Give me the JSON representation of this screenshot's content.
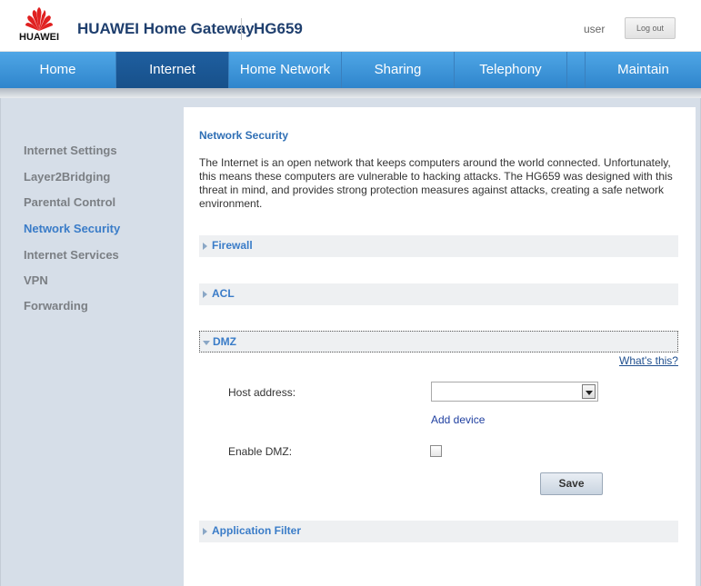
{
  "header": {
    "logo_text": "HUAWEI",
    "title": "HUAWEI Home Gateway",
    "model": "HG659",
    "user_label": "user",
    "logout_label": "Log out"
  },
  "nav": {
    "items": [
      {
        "label": "Home"
      },
      {
        "label": "Internet"
      },
      {
        "label": "Home Network"
      },
      {
        "label": "Sharing"
      },
      {
        "label": "Telephony"
      },
      {
        "label": "Maintain"
      }
    ],
    "active": "Internet"
  },
  "sidebar": {
    "items": [
      {
        "label": "Internet Settings"
      },
      {
        "label": "Layer2Bridging"
      },
      {
        "label": "Parental Control"
      },
      {
        "label": "Network Security"
      },
      {
        "label": "Internet Services"
      },
      {
        "label": "VPN"
      },
      {
        "label": "Forwarding"
      }
    ],
    "active": "Network Security"
  },
  "main": {
    "title": "Network Security",
    "intro": "The Internet is an open network that keeps computers around the world connected. Unfortunately, this means these computers are vulnerable to hacking attacks. The HG659 was designed with this threat in mind, and provides strong protection measures against attacks, creating a safe network environment.",
    "sections": {
      "firewall": "Firewall",
      "acl": "ACL",
      "dmz": "DMZ",
      "app_filter": "Application Filter"
    },
    "dmz": {
      "whats_this": "What's this?",
      "host_address_label": "Host address:",
      "host_address_value": "",
      "add_device": "Add device",
      "enable_label": "Enable DMZ:",
      "enabled": false,
      "save_label": "Save"
    }
  },
  "colors": {
    "nav_bg": "#3d95dc",
    "nav_active": "#1b5895",
    "link_blue": "#3a7cc8",
    "sidebar_bg": "#d6dee8"
  }
}
